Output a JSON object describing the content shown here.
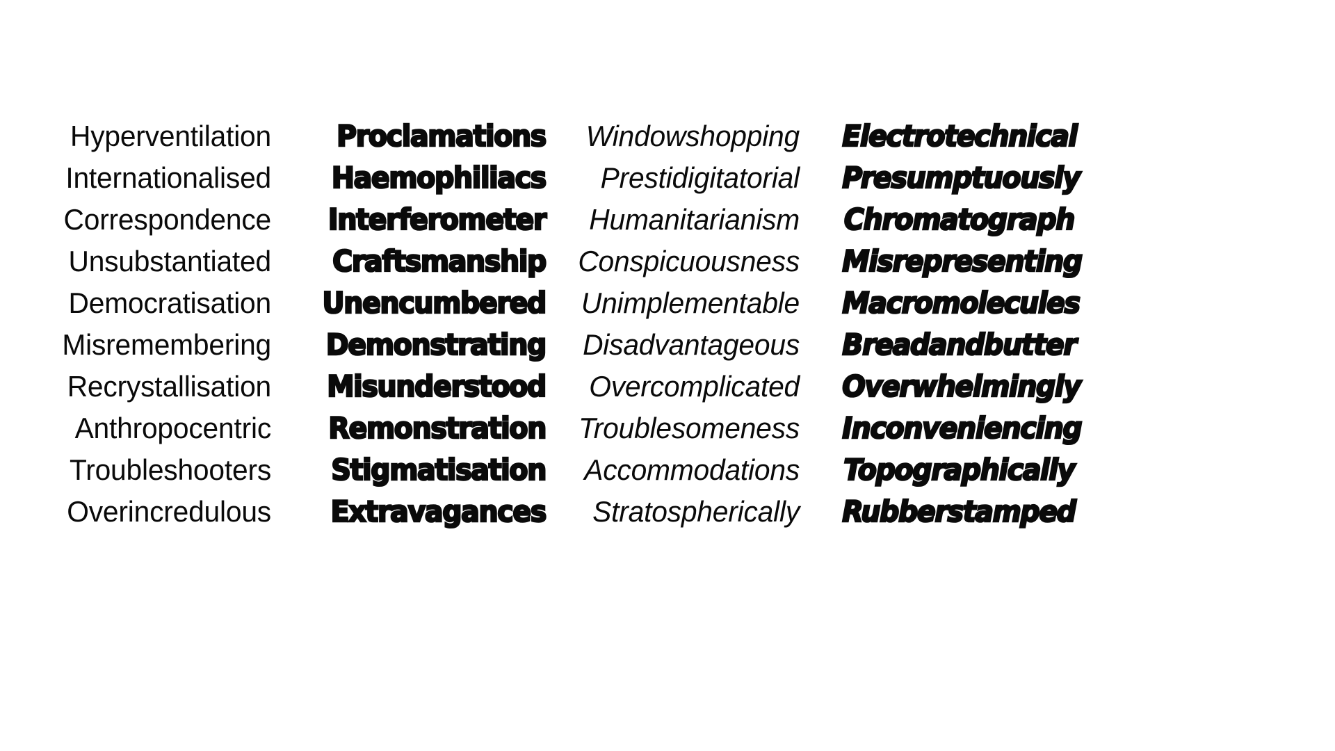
{
  "sheet": {
    "background_color": "#ffffff",
    "text_color": "#0a0a0a",
    "row_count": 10,
    "column_count": 4
  },
  "columns": [
    {
      "index": 1,
      "style_name": "light",
      "alignment": "right",
      "words": [
        "Hyperventilation",
        "Internationalised",
        "Correspondence",
        "Unsubstantiated",
        "Democratisation",
        "Misremembering",
        "Recrystallisation",
        "Anthropocentric",
        "Troubleshooters",
        "Overincredulous"
      ]
    },
    {
      "index": 2,
      "style_name": "black",
      "alignment": "right",
      "words": [
        "Proclamations",
        "Haemophiliacs",
        "Interferometer",
        "Craftsmanship",
        "Unencumbered",
        "Demonstrating",
        "Misunderstood",
        "Remonstration",
        "Stigmatisation",
        "Extravagances"
      ]
    },
    {
      "index": 3,
      "style_name": "light-italic",
      "alignment": "right",
      "words": [
        "Windowshopping",
        "Prestidigitatorial",
        "Humanitarianism",
        "Conspicuousness",
        "Unimplementable",
        "Disadvantageous",
        "Overcomplicated",
        "Troublesomeness",
        "Accommodations",
        "Stratospherically"
      ]
    },
    {
      "index": 4,
      "style_name": "black-italic",
      "alignment": "right",
      "words": [
        "Electrotechnical",
        "Presumptuously",
        "Chromatograph",
        "Misrepresenting",
        "Macromolecules",
        "Breadandbutter",
        "Overwhelmingly",
        "Inconveniencing",
        "Topographically",
        "Rubberstamped"
      ]
    }
  ]
}
